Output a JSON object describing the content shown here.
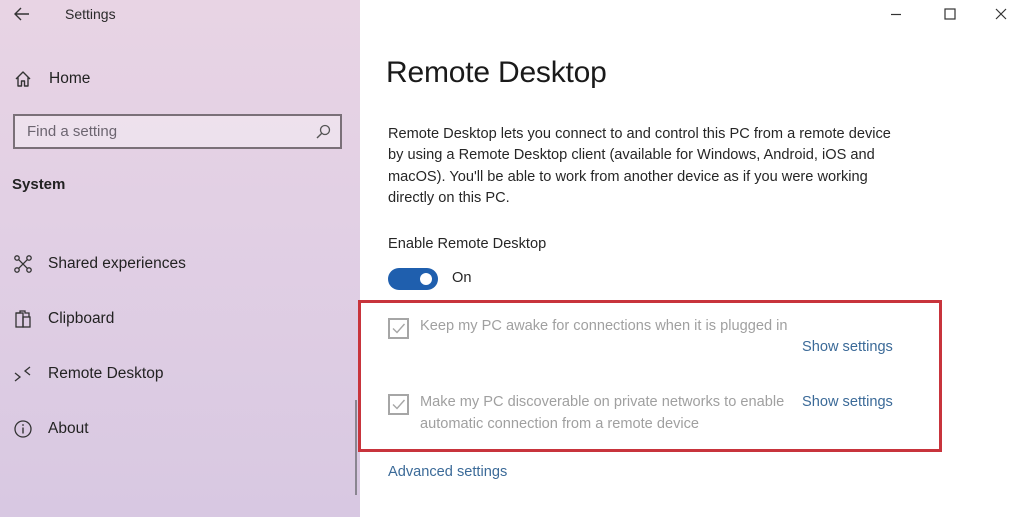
{
  "window": {
    "app_title": "Settings",
    "back_icon": "back-arrow-icon",
    "controls": {
      "minimize_icon": "minimize-icon",
      "maximize_icon": "maximize-icon",
      "close_icon": "close-icon"
    }
  },
  "sidebar": {
    "home": {
      "label": "Home",
      "icon": "home-icon"
    },
    "search": {
      "placeholder": "Find a setting",
      "value": "",
      "icon": "search-icon"
    },
    "section_heading": "System",
    "items": [
      {
        "label": "Shared experiences",
        "icon": "shared-experiences-icon"
      },
      {
        "label": "Clipboard",
        "icon": "clipboard-icon"
      },
      {
        "label": "Remote Desktop",
        "icon": "remote-desktop-icon"
      },
      {
        "label": "About",
        "icon": "info-icon"
      }
    ]
  },
  "main": {
    "title": "Remote Desktop",
    "description": "Remote Desktop lets you connect to and control this PC from a remote device by using a Remote Desktop client (available for Windows, Android, iOS and macOS). You'll be able to work from another device as if you were working directly on this PC.",
    "enable": {
      "heading": "Enable Remote Desktop",
      "state_label": "On",
      "is_on": true
    },
    "options": [
      {
        "label": "Keep my PC awake for connections when it is plugged in",
        "checked": true,
        "disabled": true,
        "link": "Show settings"
      },
      {
        "label": "Make my PC discoverable on private networks to enable automatic connection from a remote device",
        "checked": true,
        "disabled": true,
        "link": "Show settings"
      }
    ],
    "advanced_link": "Advanced settings"
  },
  "colors": {
    "accent": "#1f5fae",
    "link": "#3b6a98",
    "highlight_border": "#c8343c",
    "sidebar_top": "#e8d4e4",
    "sidebar_bottom": "#d8c8e2",
    "disabled_text": "#a0a0a0"
  }
}
